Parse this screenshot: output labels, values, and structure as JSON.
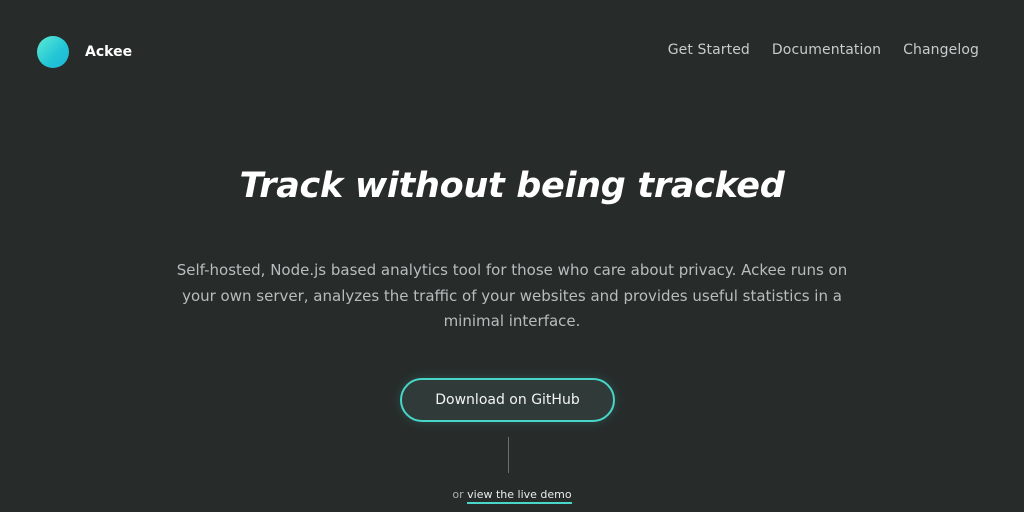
{
  "header": {
    "brand_name": "Ackee",
    "nav": [
      {
        "label": "Get Started"
      },
      {
        "label": "Documentation"
      },
      {
        "label": "Changelog"
      }
    ]
  },
  "hero": {
    "title": "Track without being tracked",
    "description": "Self-hosted, Node.js based analytics tool for those who care about privacy. Ackee runs on your own server, analyzes the traffic of your websites and provides useful statistics in a minimal interface.",
    "cta_label": "Download on GitHub",
    "demo_prefix": "or",
    "demo_link_label": "view the live demo"
  },
  "colors": {
    "background": "#272c2b",
    "accent": "#48d6c9",
    "logo_gradient_start": "#5eead4",
    "logo_gradient_end": "#1fb5d8"
  },
  "icons": {
    "logo": "ackee-logo-icon"
  }
}
